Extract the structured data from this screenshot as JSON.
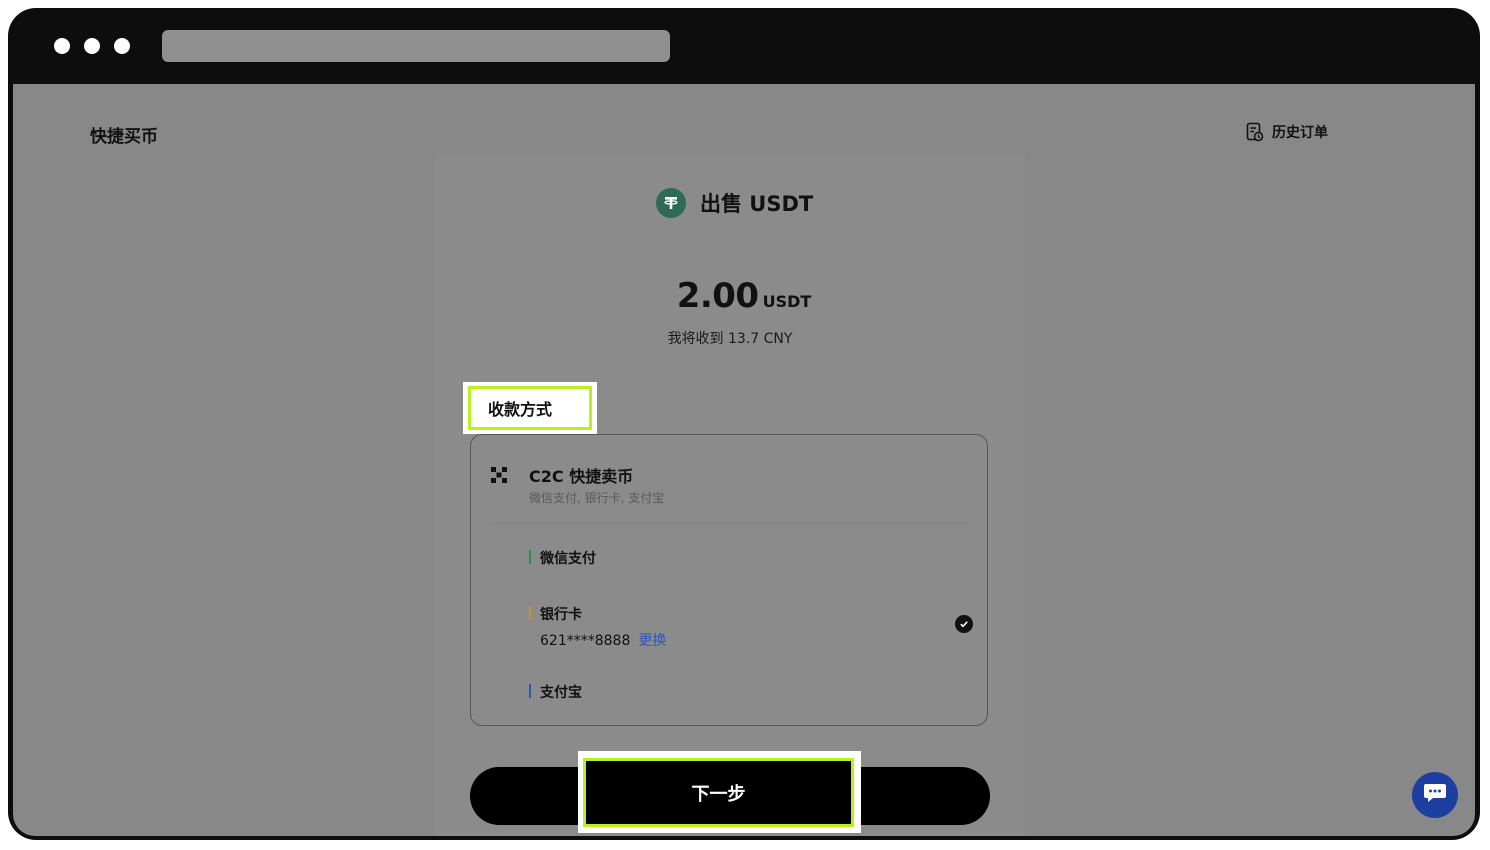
{
  "window": {
    "url": ""
  },
  "header": {
    "title": "快捷买币",
    "history_label": "历史订单"
  },
  "sell": {
    "title": "出售 USDT",
    "amount": "2.00",
    "unit": "USDT",
    "receive_text": "我将收到 13.7 CNY"
  },
  "payment": {
    "section_label": "收款方式",
    "provider_title": "C2C 快捷卖币",
    "provider_subtitle": "微信支付, 银行卡, 支付宝",
    "methods": [
      {
        "label": "微信支付",
        "accent": "#2e8b57"
      },
      {
        "label": "银行卡",
        "accent": "#c7913a",
        "card_number": "621****8888",
        "change_label": "更换",
        "selected": true
      },
      {
        "label": "支付宝",
        "accent": "#2c55b8"
      }
    ]
  },
  "actions": {
    "next_label": "下一步"
  },
  "colors": {
    "highlight": "#b9f01f",
    "link": "#2c55b8",
    "chat": "#1d3fa0"
  }
}
